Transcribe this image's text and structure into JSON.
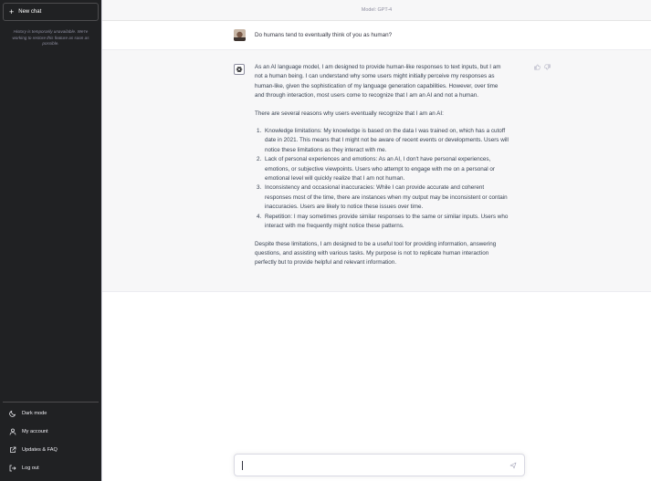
{
  "sidebar": {
    "new_chat_label": "New chat",
    "history_note": "History is temporarily unavailable. We're working to restore this feature as soon as possible.",
    "items": [
      {
        "label": "Dark mode",
        "icon": "moon-icon"
      },
      {
        "label": "My account",
        "icon": "user-icon"
      },
      {
        "label": "Updates & FAQ",
        "icon": "external-link-icon"
      },
      {
        "label": "Log out",
        "icon": "logout-icon"
      }
    ]
  },
  "header": {
    "model_label": "Model: GPT-4"
  },
  "conversation": {
    "user_message": "Do humans tend to eventually think of you as human?",
    "assistant": {
      "p1": "As an AI language model, I am designed to provide human-like responses to text inputs, but I am not a human being. I can understand why some users might initially perceive my responses as human-like, given the sophistication of my language generation capabilities. However, over time and through interaction, most users come to recognize that I am an AI and not a human.",
      "p2": "There are several reasons why users eventually recognize that I am an AI:",
      "list": [
        "Knowledge limitations: My knowledge is based on the data I was trained on, which has a cutoff date in 2021. This means that I might not be aware of recent events or developments. Users will notice these limitations as they interact with me.",
        "Lack of personal experiences and emotions: As an AI, I don't have personal experiences, emotions, or subjective viewpoints. Users who attempt to engage with me on a personal or emotional level will quickly realize that I am not human.",
        "Inconsistency and occasional inaccuracies: While I can provide accurate and coherent responses most of the time, there are instances when my output may be inconsistent or contain inaccuracies. Users are likely to notice these issues over time.",
        "Repetition: I may sometimes provide similar responses to the same or similar inputs. Users who interact with me frequently might notice these patterns."
      ],
      "p3": "Despite these limitations, I am designed to be a useful tool for providing information, answering questions, and assisting with various tasks. My purpose is not to replicate human interaction perfectly but to provide helpful and relevant information."
    }
  },
  "input": {
    "value": "",
    "placeholder": ""
  },
  "colors": {
    "sidebar_bg": "#202123",
    "assistant_bg": "#f7f7f8",
    "text": "#374151"
  }
}
